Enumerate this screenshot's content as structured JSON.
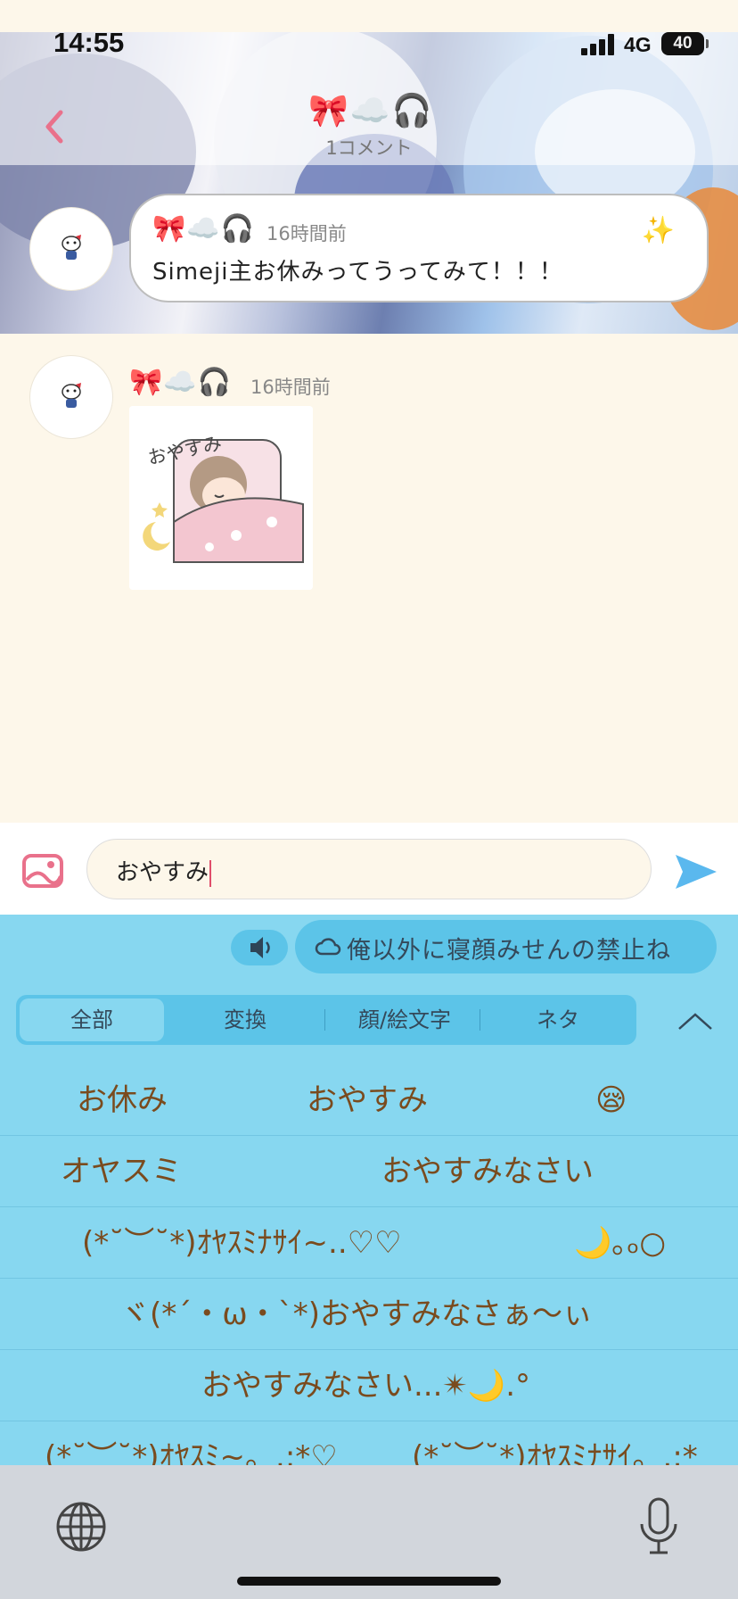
{
  "status_bar": {
    "time": "14:55",
    "network": "4G",
    "battery": "40"
  },
  "header": {
    "title_icons": "🎀☁️🎧",
    "subtitle": "1コメント"
  },
  "comments": [
    {
      "icons": "🎀☁️🎧",
      "time_ago": "16時間前",
      "text": "Simeji主お休みってうってみて！！！",
      "sparkle": "✨"
    },
    {
      "icons": "🎀☁️🎧",
      "time_ago": "16時間前",
      "sticker_text": "おやすみ"
    }
  ],
  "composer": {
    "value": "おやすみ"
  },
  "keyboard": {
    "suggestion_pill": "俺以外に寝顔みせんの禁止ね",
    "tabs": [
      "全部",
      "変換",
      "顔/絵文字",
      "ネタ"
    ],
    "active_tab": "全部",
    "candidates": [
      [
        "お休み",
        "おやすみ",
        "😪"
      ],
      [
        "オヤスミ",
        "おやすみなさい"
      ],
      [
        "(*˘︶˘*)ｵﾔｽﾐﾅｻｲ~..♡♡",
        "🌙｡ₒ○"
      ],
      [
        "ヾ(*´・ω・`*)おやすみなさぁ〜ぃ"
      ],
      [
        "おやすみなさい...✴︎🌙.°"
      ],
      [
        "(*˘︶˘*)ｵﾔｽﾐ~。.:*♡",
        "(*˘︶˘*)ｵﾔｽﾐﾅｻｲ。.:*"
      ]
    ]
  },
  "colors": {
    "accent_pink": "#e9718b",
    "send_blue": "#5ab8ee",
    "keyboard_bg": "#87d7f0",
    "candidate_text": "#7a4b1e",
    "page_bg": "#fdf7ea"
  }
}
